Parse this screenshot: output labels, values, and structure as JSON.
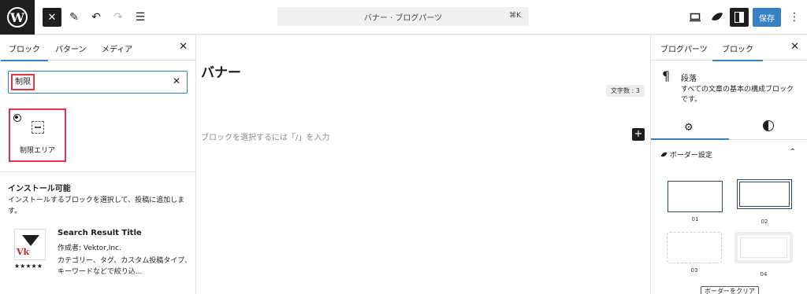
{
  "topbar": {
    "logo": "W",
    "close_icon": "✕",
    "edit_icon": "✎",
    "undo_icon": "↶",
    "redo_icon": "↷",
    "list_view_icon": "☰",
    "document_title": "バナー · ブログパーツ",
    "shortcut": "⌘K",
    "save_label": "保存",
    "more_icon": "⋮",
    "accent_color": "#3582c4"
  },
  "inserter": {
    "tabs": [
      "ブロック",
      "パターン",
      "メディア"
    ],
    "close_icon": "✕",
    "search_value": "制限",
    "search_clear_icon": "✕",
    "result_block_label": "制限エリア",
    "installable_title": "インストール可能",
    "installable_desc": "インストールするブロックを選択して、投稿に追加します。",
    "plugin": {
      "name": "Search Result Title",
      "author": "作成者: Vektor,Inc.",
      "description": "カテゴリー、タグ、カスタム投稿タイプ、キーワードなどで絞り込...",
      "logo_text": "Vk",
      "rating_stars": "★★★★★",
      "rating": 5
    }
  },
  "editor": {
    "post_title": "バナー",
    "char_count": "文字数 : 3",
    "placeholder": "ブロックを選択するには「/」を入力",
    "add_icon": "+"
  },
  "settings": {
    "tabs": [
      "ブログパーツ",
      "ブロック"
    ],
    "close_icon": "✕",
    "block_icon": "¶",
    "block_name": "段落",
    "block_desc": "すべての文章の基本の構成ブロックです。",
    "settings_icon": "⚙",
    "border_panel_title": "ボーダー設定",
    "border_chevron": "⌃",
    "border_options": [
      "01",
      "02",
      "03",
      "04"
    ],
    "clear_button": "ボーダーをクリア"
  }
}
